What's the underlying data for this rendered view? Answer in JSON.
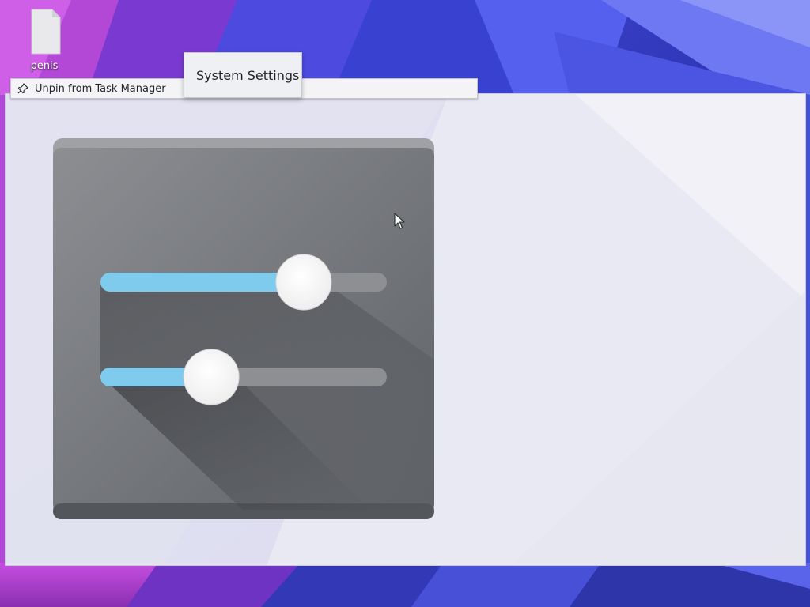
{
  "desktop": {
    "icons": [
      {
        "label": "penis",
        "icon": "file-icon"
      }
    ]
  },
  "context_menu": {
    "items": [
      {
        "label": "Unpin from Task Manager",
        "icon": "unpin-icon"
      }
    ]
  },
  "tooltip": {
    "title": "System Settings"
  },
  "preview": {
    "app": "System Settings",
    "icon": "system-settings-icon",
    "sliders": [
      {
        "level": 0.76
      },
      {
        "level": 0.36
      }
    ]
  },
  "colors": {
    "accent": "#7ecbee",
    "wallpaper_blue": "#3d43c8",
    "wallpaper_purple": "#a63bc9",
    "panel": "#ececf4",
    "icon_tile": "#6a6d72"
  }
}
